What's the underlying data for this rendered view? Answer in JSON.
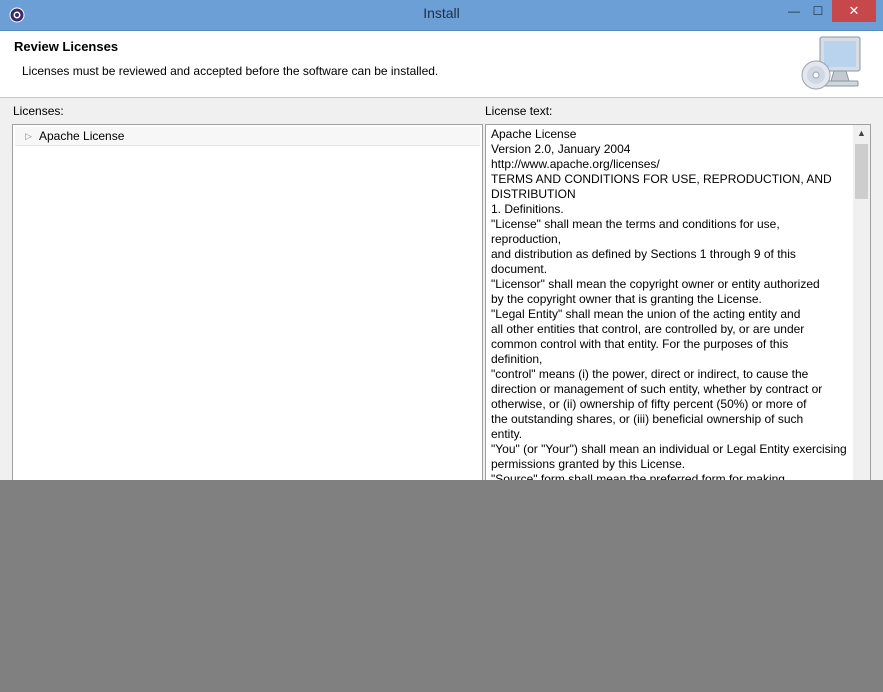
{
  "window": {
    "title": "Install",
    "minimize": "—",
    "maximize": "☐",
    "close": "✕"
  },
  "header": {
    "title": "Review Licenses",
    "description": "Licenses must be reviewed and accepted before the software can be installed."
  },
  "licenses": {
    "label": "Licenses:",
    "items": [
      {
        "label": "Apache License",
        "expanded": false
      }
    ]
  },
  "license_text": {
    "label": "License text:",
    "lines": [
      "Apache License",
      "Version 2.0, January 2004",
      "http://www.apache.org/licenses/",
      "TERMS AND CONDITIONS FOR USE, REPRODUCTION, AND",
      "DISTRIBUTION",
      "1. Definitions.",
      "\"License\" shall mean the terms and conditions for use,",
      "reproduction,",
      "and distribution as defined by Sections 1 through 9 of this",
      "document.",
      "\"Licensor\" shall mean the copyright owner or entity authorized",
      "by the copyright owner that is granting the License.",
      "\"Legal Entity\" shall mean the union of the acting entity and",
      "all other entities that control, are controlled by, or are under",
      "common control with that entity. For the purposes of this",
      "definition,",
      "\"control\" means (i) the power, direct or indirect, to cause the",
      "direction or management of such entity, whether by contract or",
      "otherwise, or (ii) ownership of fifty percent (50%) or more of",
      "the outstanding shares, or (iii) beneficial ownership of such",
      "entity.",
      "\"You\" (or \"Your\") shall mean an individual or Legal Entity exercising",
      "permissions granted by this License.",
      "\"Source\" form shall mean the preferred form for making"
    ]
  },
  "colors": {
    "titlebar": "#6b9fd6",
    "close_button": "#c7484b",
    "backdrop": "#808080"
  }
}
